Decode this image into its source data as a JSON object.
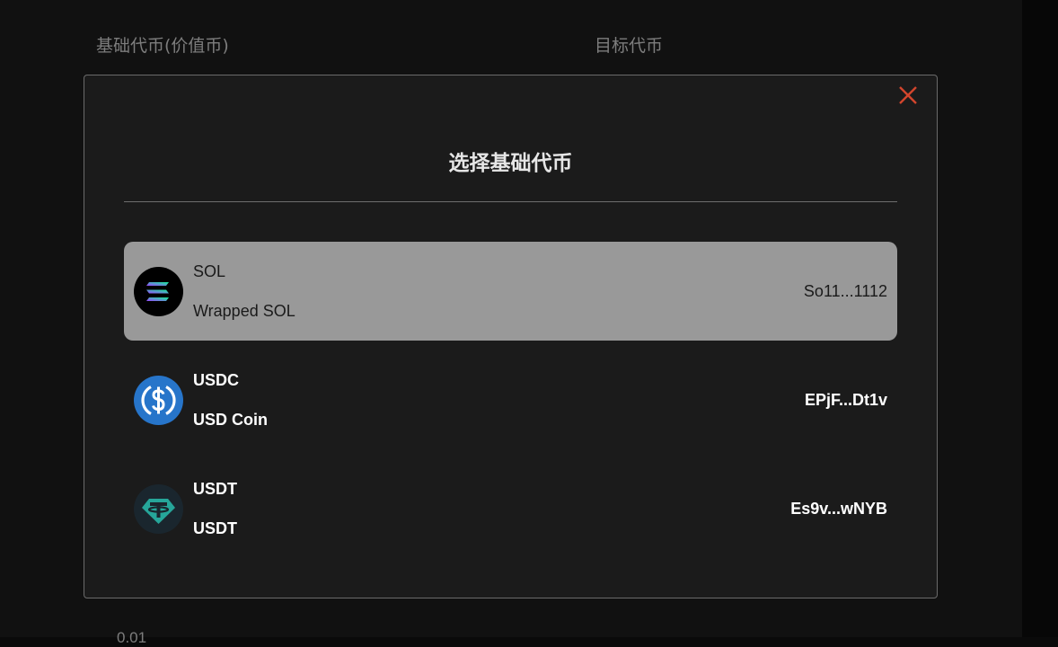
{
  "background": {
    "base_token_label": "基础代币(价值币)",
    "target_token_label": "目标代币",
    "partial_value": "0.01"
  },
  "modal": {
    "title": "选择基础代币",
    "close_icon": "close-icon",
    "accent_color": "#d2452d",
    "tokens": [
      {
        "symbol": "SOL",
        "name": "Wrapped SOL",
        "address": "So11...1112",
        "icon": "solana-icon",
        "selected": true
      },
      {
        "symbol": "USDC",
        "name": "USD Coin",
        "address": "EPjF...Dt1v",
        "icon": "usdc-icon",
        "selected": false
      },
      {
        "symbol": "USDT",
        "name": "USDT",
        "address": "Es9v...wNYB",
        "icon": "usdt-icon",
        "selected": false
      }
    ]
  }
}
